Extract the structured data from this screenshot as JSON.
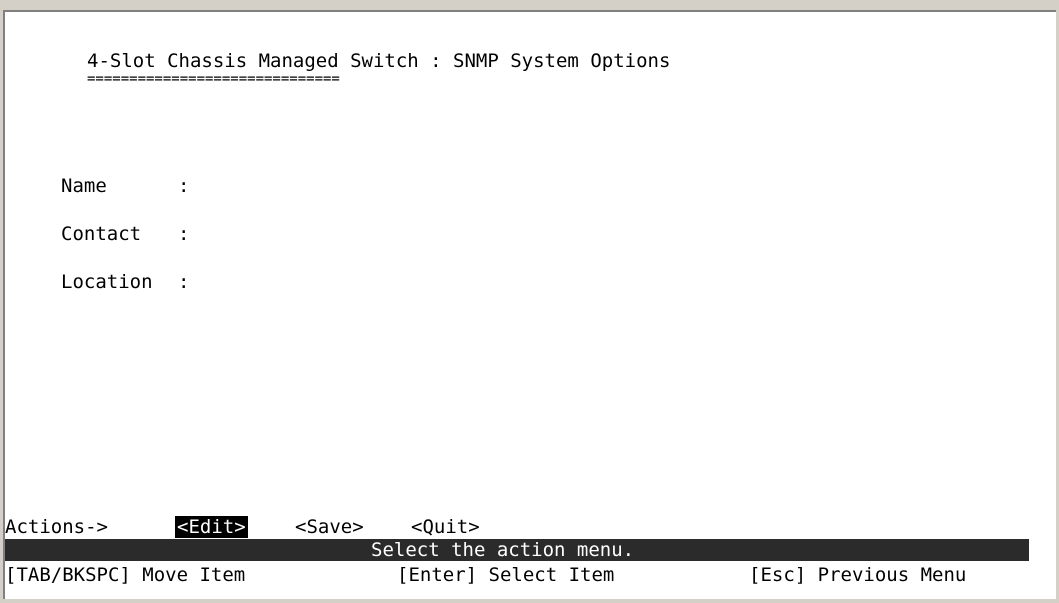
{
  "screen": {
    "title": "4-Slot Chassis Managed Switch : SNMP System Options",
    "underline": "=============================="
  },
  "fields": [
    {
      "label": "Name",
      "colon": ":",
      "value": ""
    },
    {
      "label": "Contact",
      "colon": ":",
      "value": ""
    },
    {
      "label": "Location",
      "colon": ":",
      "value": ""
    }
  ],
  "actions": {
    "prefix": "Actions->",
    "edit": "<Edit>",
    "save": "<Save>",
    "quit": "<Quit>",
    "selected": "edit"
  },
  "status": {
    "message": "Select the action menu."
  },
  "help": {
    "tab": "[TAB/BKSPC] Move Item",
    "enter": "[Enter] Select Item",
    "esc": "[Esc] Previous Menu"
  }
}
